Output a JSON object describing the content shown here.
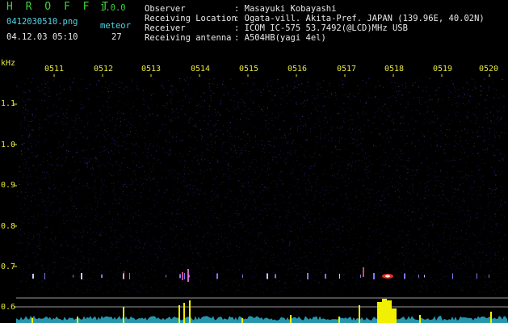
{
  "header": {
    "app_title": "H R O F F T",
    "version": "1.0.0",
    "filename": "0412030510.png",
    "datetime": "04.12.03 05:10",
    "meteor_label": "meteor",
    "meteor_count": "27"
  },
  "info": {
    "rows": [
      {
        "label": "Observer",
        "value": ": Masayuki Kobayashi"
      },
      {
        "label": "Receiving Location",
        "value": ": Ogata-vill. Akita-Pref. JAPAN (139.96E, 40.02N)"
      },
      {
        "label": "Receiver",
        "value": ": ICOM IC-575 53.7492(@LCD)MHz USB"
      },
      {
        "label": "Receiving antenna",
        "value": ": A504HB(yagi 4el)"
      }
    ]
  },
  "axis": {
    "unit": "kHz",
    "y_labels": [
      "1.1",
      "1.0",
      "0.9",
      "0.8",
      "0.7",
      "0.6"
    ],
    "x_labels": [
      "0511",
      "0512",
      "0513",
      "0514",
      "0515",
      "0516",
      "0517",
      "0518",
      "0519",
      "0520"
    ]
  },
  "colors": {
    "background": "#000000",
    "noise_dots": "#3a3aa8",
    "label_yellow": "#e6e63c",
    "title_green": "#3cd23c",
    "info_cyan": "#4fd6e6",
    "signal_red": "#ff3030"
  }
}
